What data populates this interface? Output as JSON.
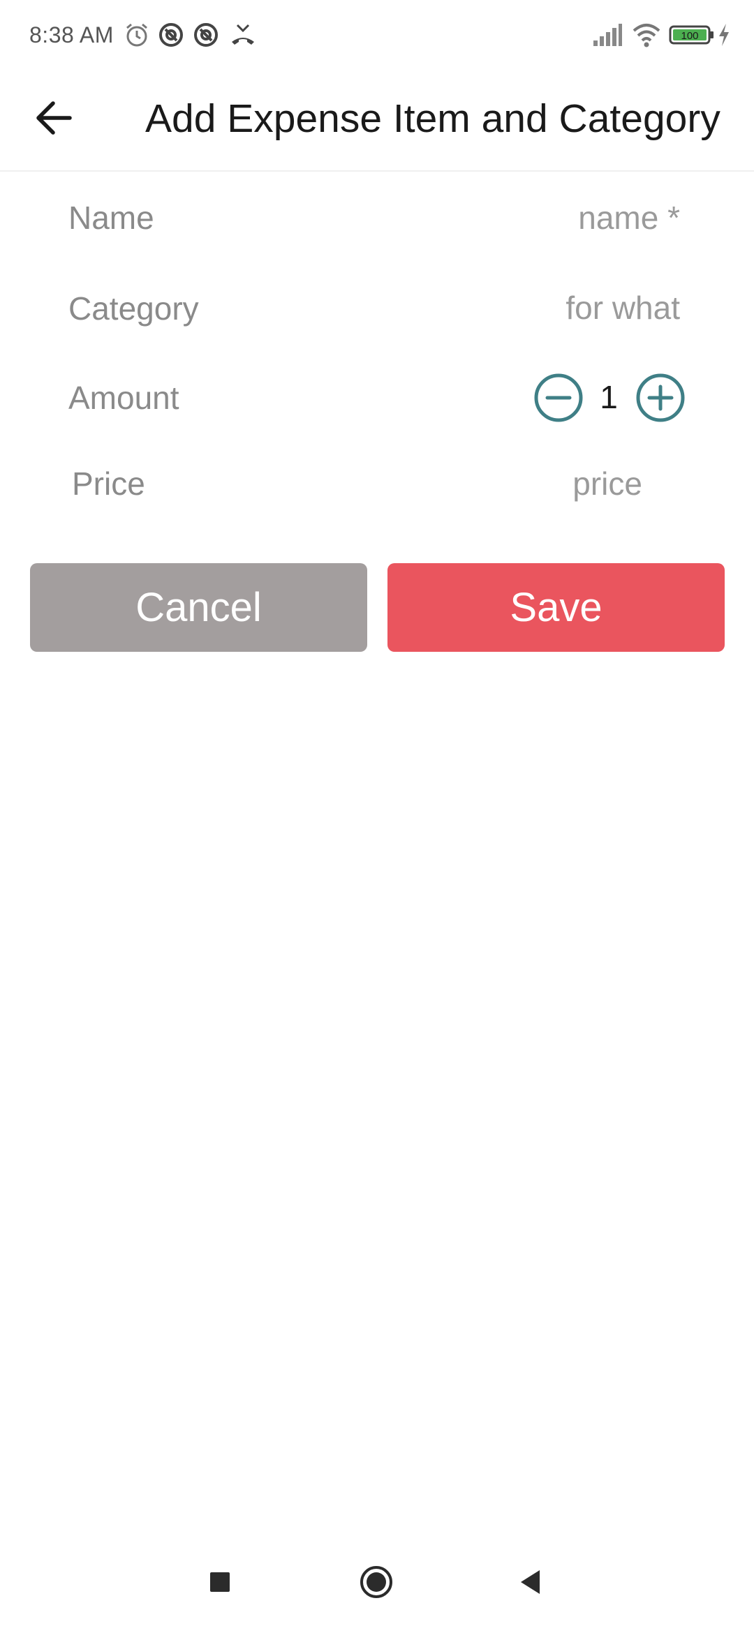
{
  "status_bar": {
    "time": "8:38 AM",
    "battery": "100",
    "left_icons": [
      "alarm-icon",
      "data-saver-icon",
      "data-saver-icon",
      "missed-call-icon"
    ],
    "right_icons": [
      "signal-icon",
      "wifi-icon",
      "battery-icon",
      "charging-icon"
    ]
  },
  "app_bar": {
    "back_icon": "arrow-left-icon",
    "title": "Add Expense Item and Category"
  },
  "form": {
    "name": {
      "label": "Name",
      "placeholder": "name *",
      "value": ""
    },
    "category": {
      "label": "Category",
      "placeholder": "for what",
      "value": ""
    },
    "amount": {
      "label": "Amount",
      "value": "1",
      "decrement_icon": "minus-circle-icon",
      "increment_icon": "plus-circle-icon"
    },
    "price": {
      "label": "Price",
      "placeholder": "price",
      "value": ""
    }
  },
  "actions": {
    "cancel_label": "Cancel",
    "save_label": "Save"
  },
  "colors": {
    "accent_teal": "#3f7f86",
    "save_red": "#ea555e",
    "cancel_gray": "#a39e9e",
    "battery_green": "#4caf50"
  },
  "nav_bar": {
    "icons": [
      "recents-square-icon",
      "home-circle-icon",
      "back-triangle-icon"
    ]
  }
}
